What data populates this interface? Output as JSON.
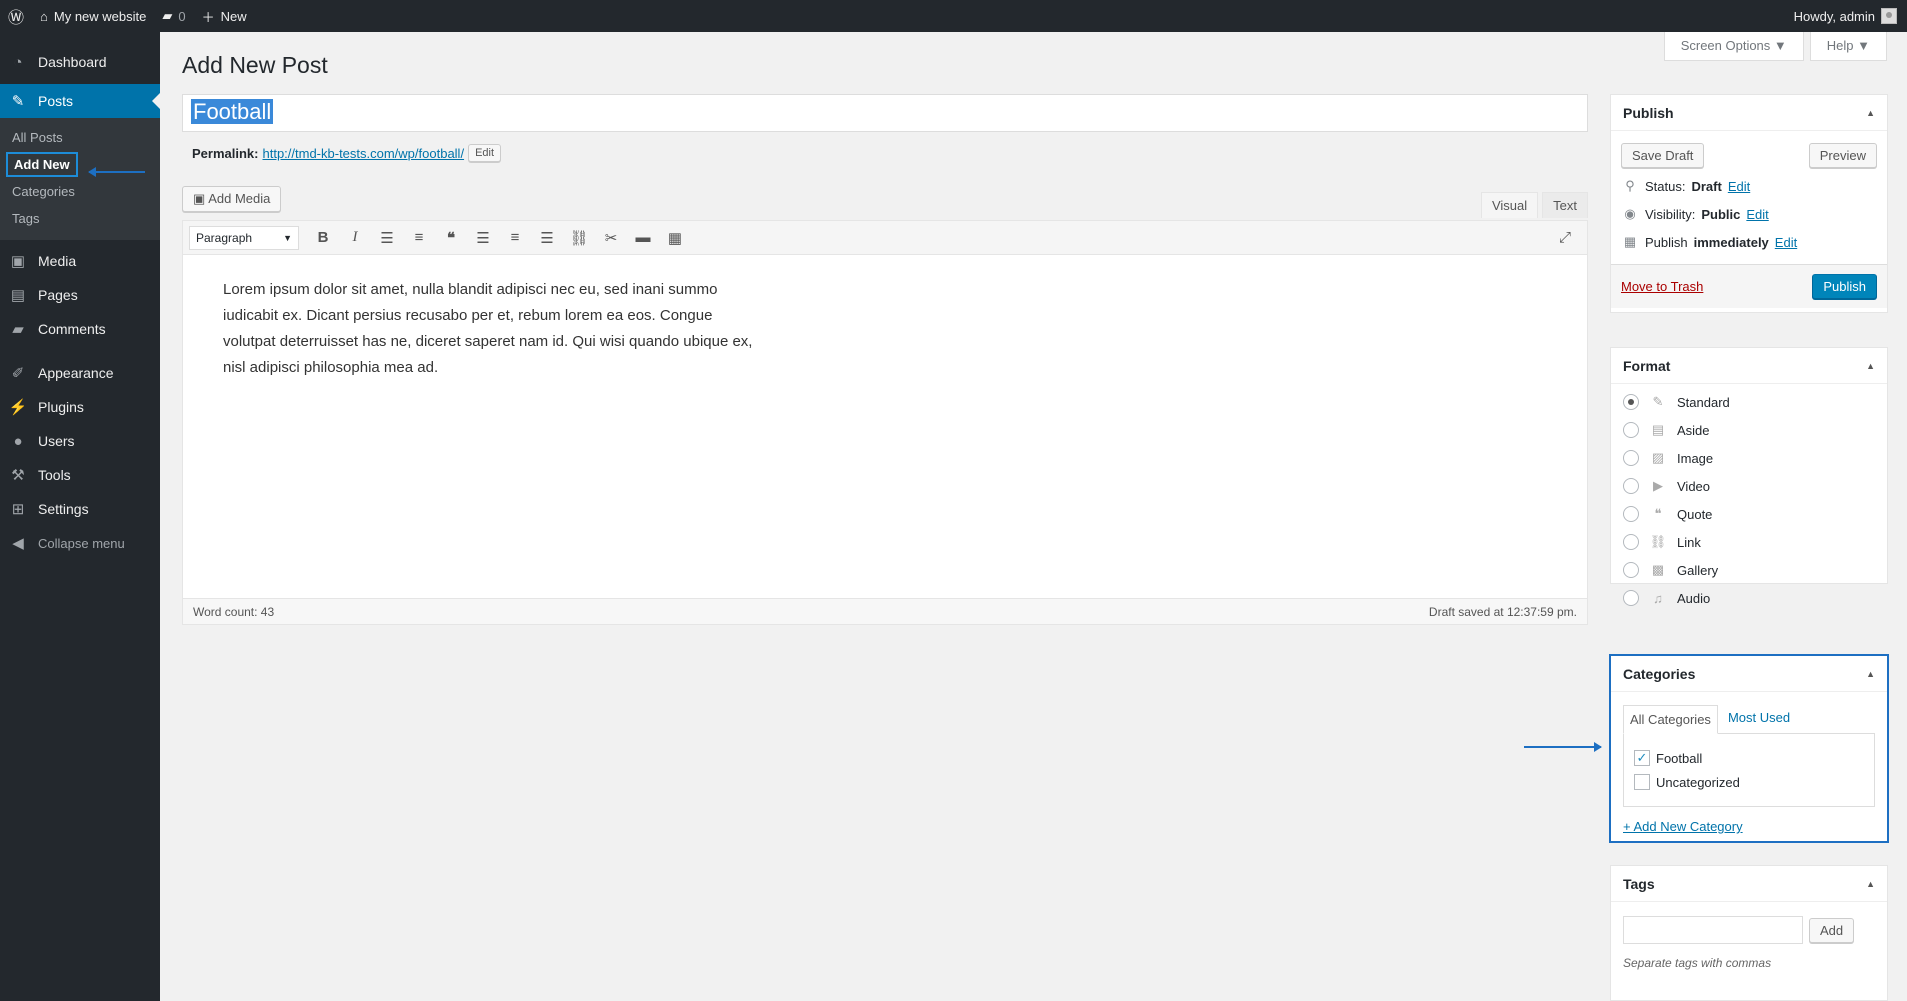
{
  "adminbar": {
    "site_name": "My new website",
    "comments_count": "0",
    "new_label": "New",
    "howdy": "Howdy, admin"
  },
  "sidebar": {
    "dashboard": "Dashboard",
    "posts": "Posts",
    "posts_sub": [
      "All Posts",
      "Add New",
      "Categories",
      "Tags"
    ],
    "media": "Media",
    "pages": "Pages",
    "comments": "Comments",
    "appearance": "Appearance",
    "plugins": "Plugins",
    "users": "Users",
    "tools": "Tools",
    "settings": "Settings",
    "collapse": "Collapse menu"
  },
  "header": {
    "screen_options": "Screen Options ▼",
    "help": "Help ▼",
    "page_title": "Add New Post"
  },
  "post": {
    "title": "Football",
    "permalink_label": "Permalink:",
    "permalink_url": "http://tmd-kb-tests.com/wp/football/",
    "permalink_edit": "Edit",
    "add_media": "Add Media",
    "tab_visual": "Visual",
    "tab_text": "Text",
    "format_select": "Paragraph",
    "content": "Lorem ipsum dolor sit amet, nulla blandit adipisci nec eu, sed inani summo iudicabit ex. Dicant persius recusabo per et, rebum lorem ea eos. Congue volutpat deterruisset has ne, diceret saperet nam id. Qui wisi quando ubique ex, nisl adipisci philosophia mea ad.",
    "word_count": "Word count: 43",
    "draft_saved": "Draft saved at 12:37:59 pm."
  },
  "publish": {
    "title": "Publish",
    "save_draft": "Save Draft",
    "preview": "Preview",
    "status_label": "Status:",
    "status_value": "Draft",
    "visibility_label": "Visibility:",
    "visibility_value": "Public",
    "publish_label": "Publish",
    "publish_value": "immediately",
    "edit": "Edit",
    "move_to_trash": "Move to Trash",
    "publish_button": "Publish"
  },
  "format": {
    "title": "Format",
    "options": [
      "Standard",
      "Aside",
      "Image",
      "Video",
      "Quote",
      "Link",
      "Gallery",
      "Audio"
    ],
    "selected": "Standard"
  },
  "categories": {
    "title": "Categories",
    "tab_all": "All Categories",
    "tab_most_used": "Most Used",
    "items": [
      "Football",
      "Uncategorized"
    ],
    "checked": "Football",
    "add_new": "+ Add New Category"
  },
  "tags": {
    "title": "Tags",
    "add_button": "Add",
    "hint": "Separate tags with commas"
  },
  "colors": {
    "sidebar_bg": "#23282d",
    "accent": "#0073aa",
    "highlight": "#1d6fc2"
  }
}
